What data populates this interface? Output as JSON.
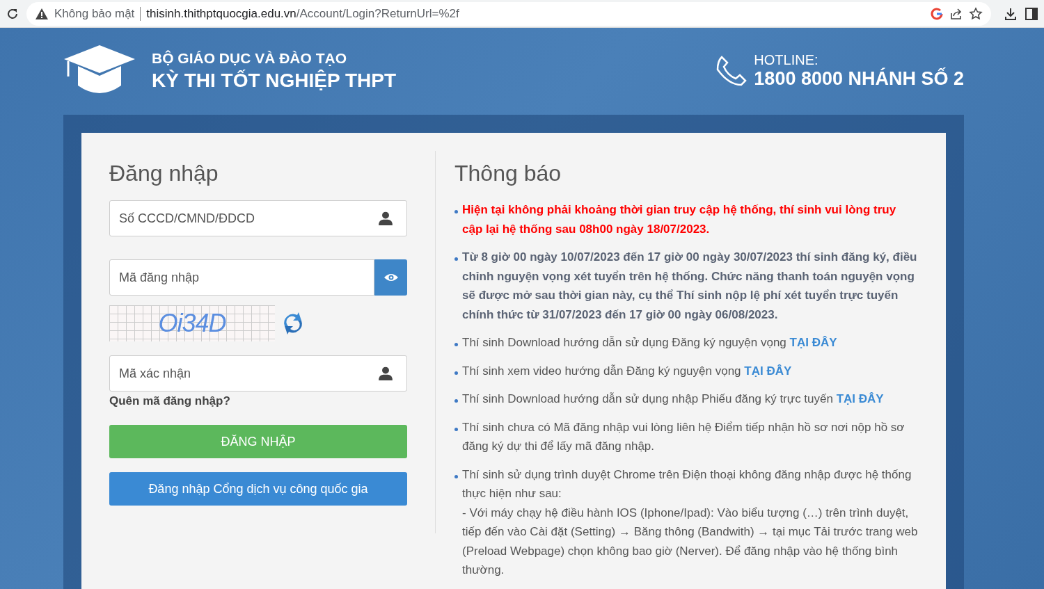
{
  "browser": {
    "security": "Không bảo mật",
    "url": "thisinh.thithptquocgia.edu.vn",
    "url_path": "/Account/Login?ReturnUrl=%2f"
  },
  "header": {
    "ministry": "BỘ GIÁO DỤC VÀ ĐÀO TẠO",
    "exam": "KỲ THI TỐT NGHIỆP THPT",
    "hotline_label": "HOTLINE:",
    "hotline": "1800 8000 NHÁNH SỐ 2"
  },
  "login": {
    "title": "Đăng nhập",
    "id_placeholder": "Số CCCD/CMND/ĐDCD",
    "code_placeholder": "Mã đăng nhập",
    "captcha": "Oi34D",
    "captcha_placeholder": "Mã xác nhận",
    "forgot": "Quên mã đăng nhập?",
    "submit": "ĐĂNG NHẬP",
    "national_login": "Đăng nhập Cổng dịch vụ công quốc gia"
  },
  "notices": {
    "title": "Thông báo",
    "items": [
      {
        "kind": "alert",
        "text": "Hiện tại không phải khoảng thời gian truy cập hệ thống, thí sinh vui lòng truy cập lại hệ thống sau 08h00 ngày 18/07/2023."
      },
      {
        "kind": "bold",
        "text": "Từ 8 giờ 00 ngày 10/07/2023 đến 17 giờ 00 ngày 30/07/2023 thí sinh đăng ký, điều chỉnh nguyện vọng xét tuyển trên hệ thống. Chức năng thanh toán nguyện vọng sẽ được mở sau thời gian này, cụ thể Thí sinh nộp lệ phí xét tuyển trực tuyến chính thức từ 31/07/2023 đến 17 giờ 00 ngày 06/08/2023."
      },
      {
        "kind": "link",
        "text": "Thí sinh Download hướng dẫn sử dụng Đăng ký nguyện vọng",
        "link": "TẠI ĐÂY"
      },
      {
        "kind": "link",
        "text": "Thí sinh xem video hướng dẫn Đăng ký nguyện vọng",
        "link": "TẠI ĐÂY"
      },
      {
        "kind": "link",
        "text": "Thí sinh Download hướng dẫn sử dụng nhập Phiếu đăng ký trực tuyến",
        "link": "TẠI ĐÂY"
      },
      {
        "kind": "plain",
        "text": "Thí sinh chưa có Mã đăng nhập vui lòng liên hệ Điểm tiếp nhận hồ sơ nơi nộp hồ sơ đăng ký dự thi để lấy mã đăng nhập."
      },
      {
        "kind": "plain",
        "text": "Thí sinh sử dụng trình duyệt Chrome trên Điện thoại không đăng nhập được hệ thống thực hiện như sau:",
        "detail": " - Với máy chạy hệ điều hành IOS (Iphone/Ipad): Vào biểu tượng (…) trên trình duyệt, tiếp đến vào Cài đặt (Setting) → Băng thông (Bandwith) → tại mục Tải trước trang web (Preload Webpage) chọn không bao giờ (Nerver). Để đăng nhập vào hệ thống bình thường."
      }
    ]
  }
}
